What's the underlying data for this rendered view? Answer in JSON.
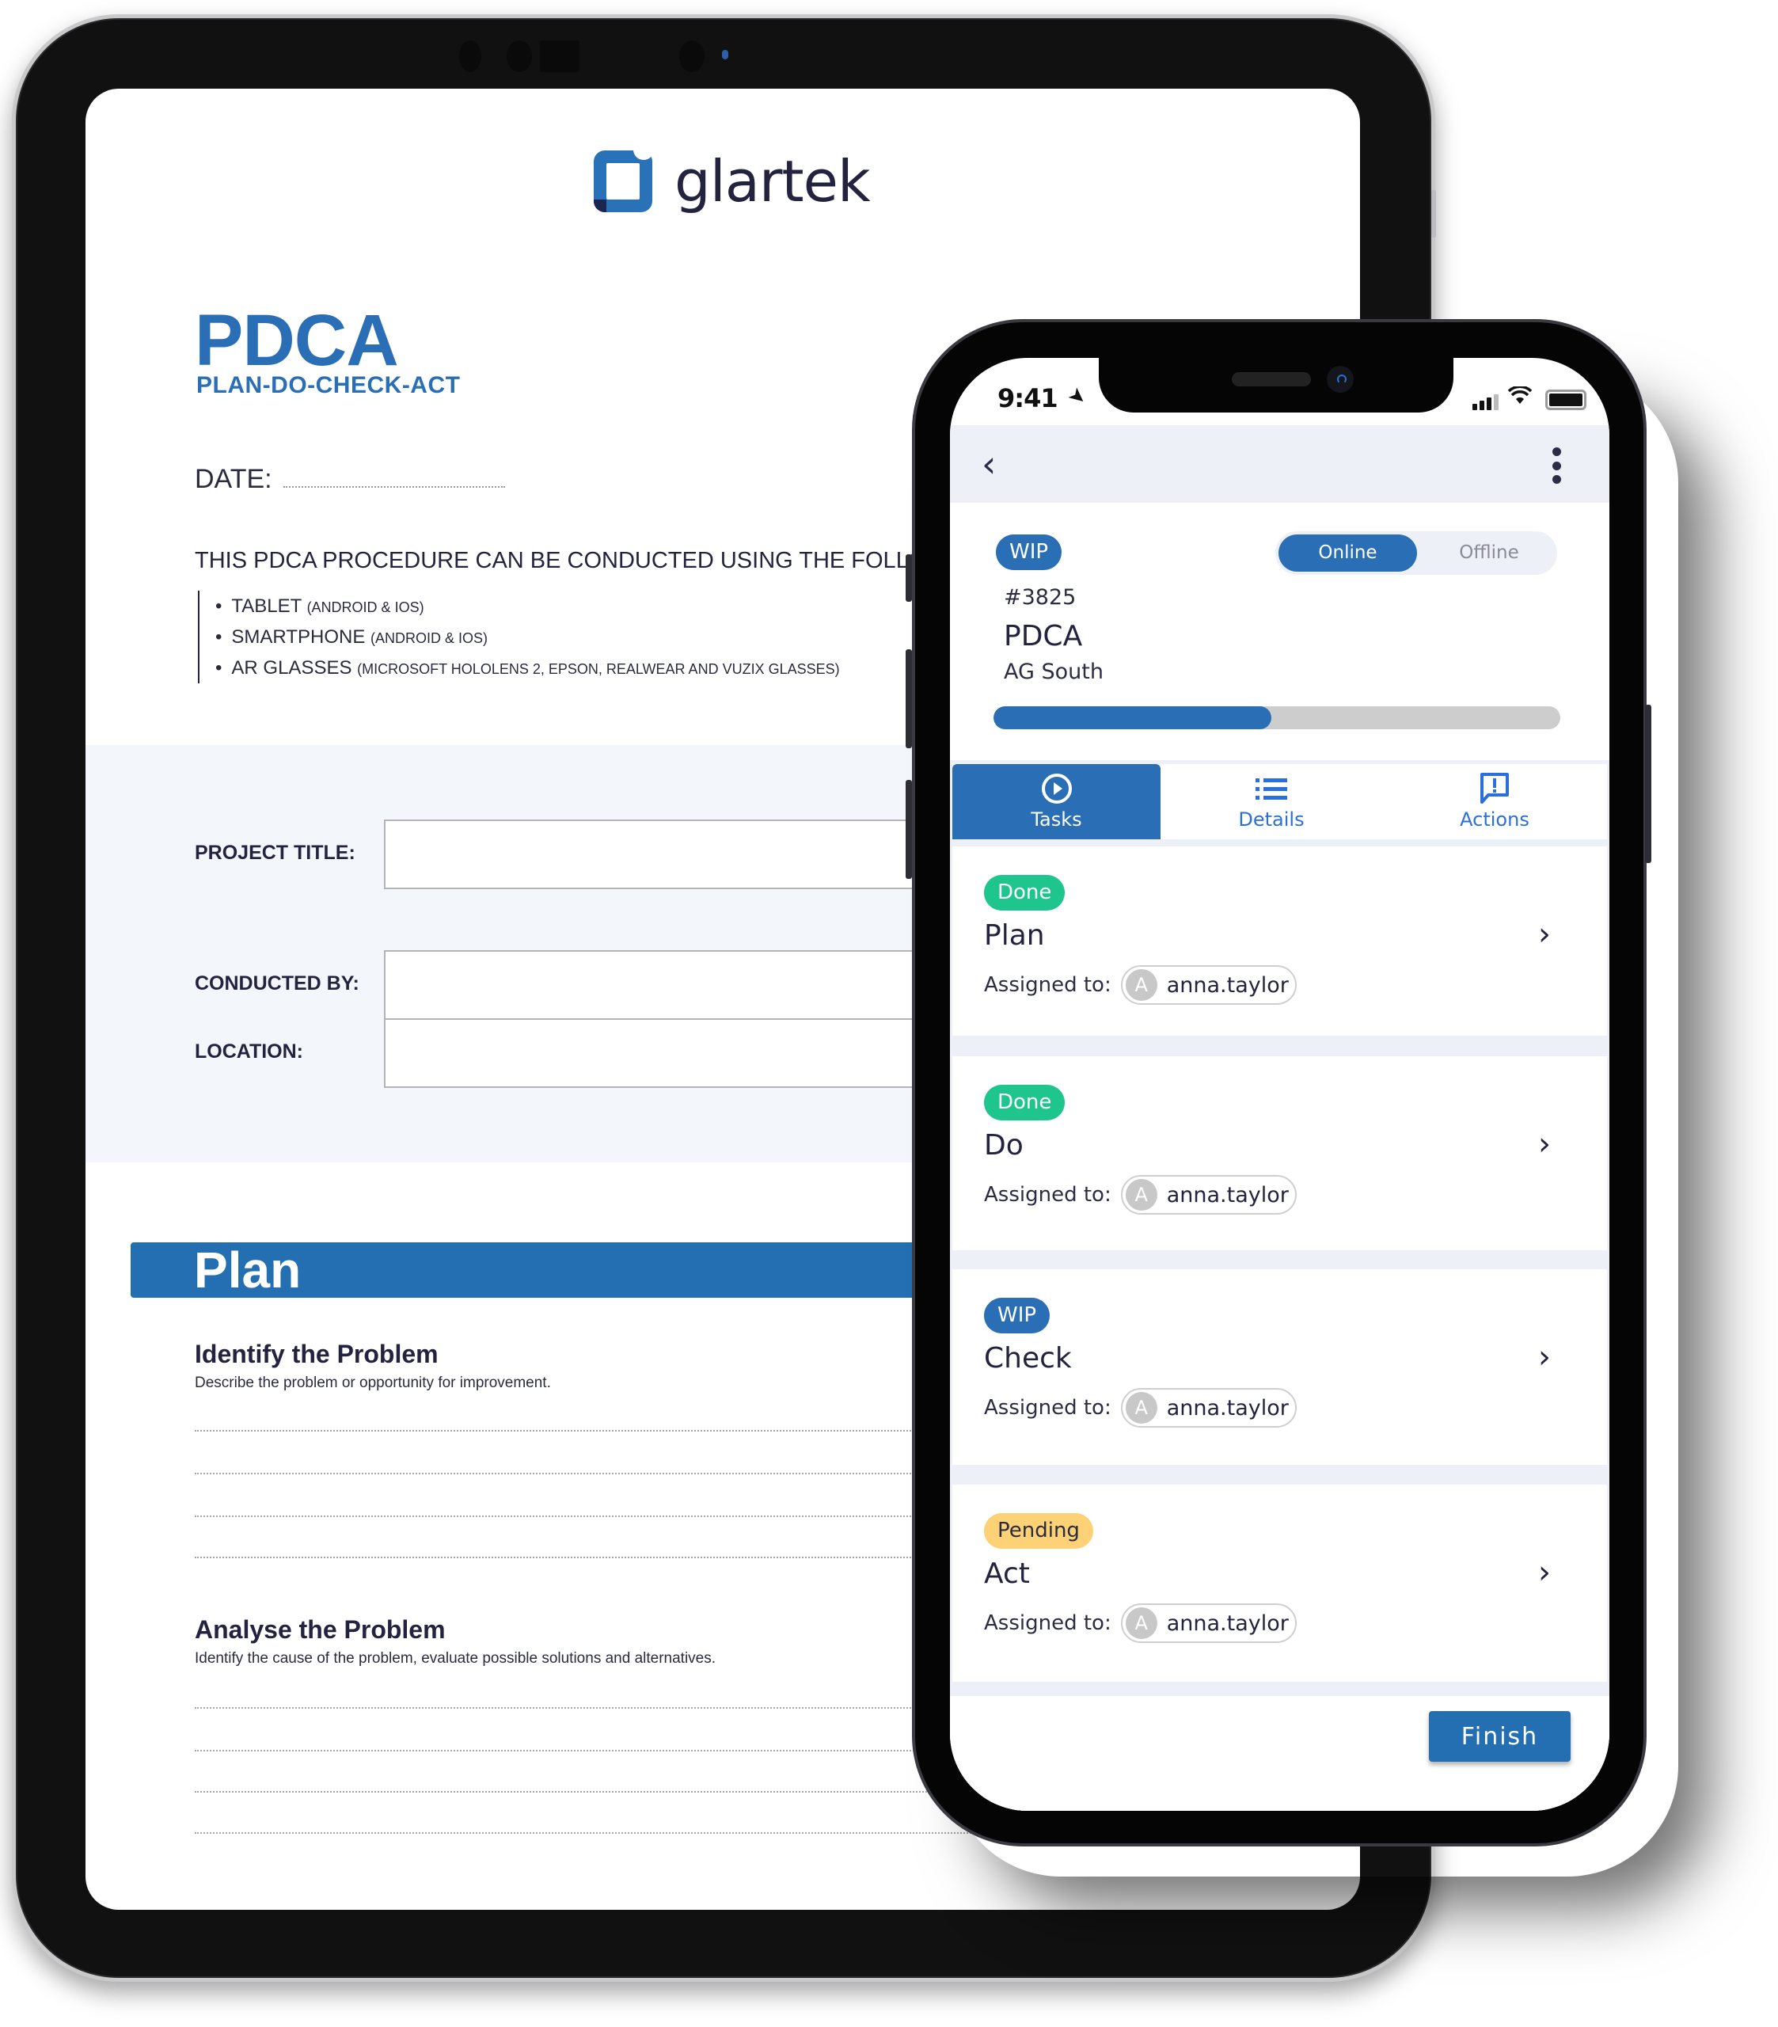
{
  "tablet": {
    "brand": "glartek",
    "doc_title": "PDCA",
    "doc_subtitle": "PLAN-DO-CHECK-ACT",
    "date_label": "DATE:",
    "intro_text": "THIS PDCA PROCEDURE CAN BE CONDUCTED USING THE FOLLOWING F",
    "devices": [
      {
        "name": "TABLET",
        "detail": "(ANDROID & IOS)"
      },
      {
        "name": "SMARTPHONE",
        "detail": "(ANDROID & IOS)"
      },
      {
        "name": "AR GLASSES",
        "detail": "(MICROSOFT HOLOLENS 2, EPSON, REALWEAR AND VUZIX GLASSES)"
      }
    ],
    "fields": {
      "project_title": "PROJECT TITLE:",
      "conducted_by": "CONDUCTED BY:",
      "location": "LOCATION:"
    },
    "section_banner": "Plan",
    "sections": [
      {
        "heading": "Identify the Problem",
        "description": "Describe the problem or opportunity for improvement."
      },
      {
        "heading": "Analyse the Problem",
        "description": "Identify the cause of the problem, evaluate possible solutions and alternatives."
      }
    ]
  },
  "phone": {
    "status_bar": {
      "time": "9:41"
    },
    "header": {
      "status_badge": "WIP",
      "toggle": {
        "online": "Online",
        "offline": "Offline",
        "selected": "Online"
      },
      "ticket_id": "#3825",
      "title": "PDCA",
      "site": "AG South",
      "progress_fraction": 0.49
    },
    "tabs": [
      {
        "label": "Tasks",
        "icon": "play-circle-icon",
        "active": true
      },
      {
        "label": "Details",
        "icon": "list-icon",
        "active": false
      },
      {
        "label": "Actions",
        "icon": "alert-message-icon",
        "active": false
      }
    ],
    "tasks": [
      {
        "status": "Done",
        "name": "Plan",
        "assigned_label": "Assigned to:",
        "avatar_initial": "A",
        "assignee": "anna.taylor"
      },
      {
        "status": "Done",
        "name": "Do",
        "assigned_label": "Assigned to:",
        "avatar_initial": "A",
        "assignee": "anna.taylor"
      },
      {
        "status": "WIP",
        "name": "Check",
        "assigned_label": "Assigned to:",
        "avatar_initial": "A",
        "assignee": "anna.taylor"
      },
      {
        "status": "Pending",
        "name": "Act",
        "assigned_label": "Assigned to:",
        "avatar_initial": "A",
        "assignee": "anna.taylor"
      }
    ],
    "finish_label": "Finish",
    "colors": {
      "primary": "#2a6fb5",
      "done": "#1ec58c",
      "pending": "#fdd176",
      "nav_bg": "#eef0f8"
    }
  }
}
